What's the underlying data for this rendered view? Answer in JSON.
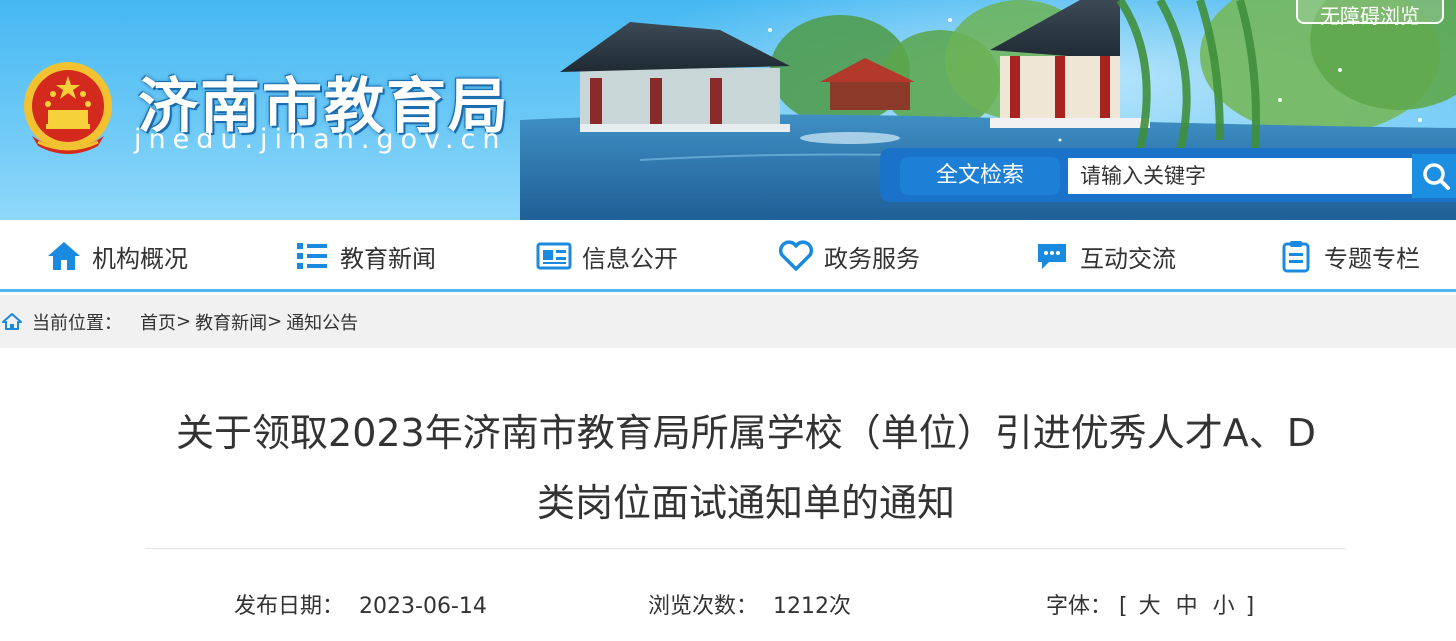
{
  "header": {
    "site_title": "济南市教育局",
    "site_domain": "jnedu.jinan.gov.cn",
    "barrier_free_label": "无障碍浏览",
    "search": {
      "label": "全文检索",
      "placeholder": "请输入关键字"
    }
  },
  "nav": {
    "items": [
      {
        "label": "机构概况",
        "icon": "home-icon"
      },
      {
        "label": "教育新闻",
        "icon": "list-icon"
      },
      {
        "label": "信息公开",
        "icon": "newspaper-icon"
      },
      {
        "label": "政务服务",
        "icon": "heart-icon"
      },
      {
        "label": "互动交流",
        "icon": "chat-icon"
      },
      {
        "label": "专题专栏",
        "icon": "clipboard-icon"
      }
    ]
  },
  "breadcrumb": {
    "label": "当前位置：",
    "items": [
      "首页",
      "教育新闻",
      "通知公告"
    ],
    "separator": ">"
  },
  "article": {
    "title_line1": "关于领取2023年济南市教育局所属学校（单位）引进优秀人才A、D",
    "title_line2": "类岗位面试通知单的通知",
    "publish_label": "发布日期：",
    "publish_date": "2023-06-14",
    "views_label": "浏览次数：",
    "views": "1212次",
    "font_label": "字体：",
    "font_open": "[",
    "font_large": "大",
    "font_medium": "中",
    "font_small": "小",
    "font_close": "]"
  },
  "colors": {
    "nav_icon": "#1a8ae0",
    "nav_underline": "#52b6f0",
    "search_bar": "#1a73c9",
    "banner_sky": "#46b8f2"
  }
}
